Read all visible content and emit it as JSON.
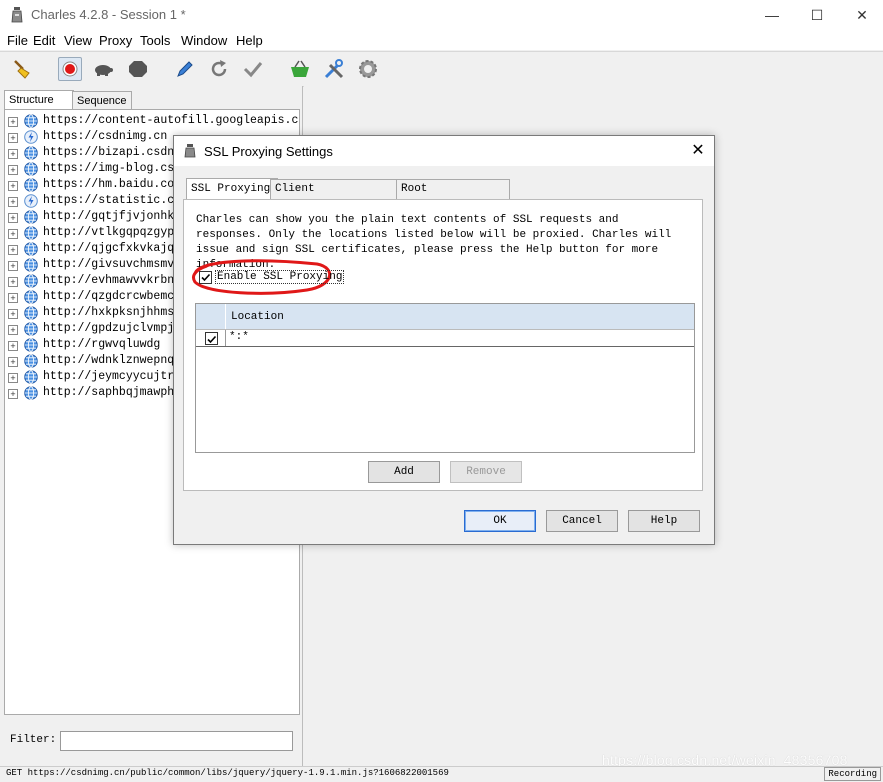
{
  "window": {
    "title": "Charles 4.2.8 - Session 1 *",
    "minimize": "—",
    "maximize": "☐",
    "close": "✕"
  },
  "menu": [
    "File",
    "Edit",
    "View",
    "Proxy",
    "Tools",
    "Window",
    "Help"
  ],
  "toolbar": {
    "icons": [
      "broom-icon",
      "record-icon",
      "turtle-icon",
      "stop-icon",
      "pen-icon",
      "refresh-icon",
      "check-icon",
      "basket-icon",
      "tools-icon",
      "settings-icon"
    ]
  },
  "left_tabs": [
    "Structure",
    "Sequence"
  ],
  "tree": [
    {
      "host": "https://content-autofill.googleapis.com",
      "icon": "globe"
    },
    {
      "host": "https://csdnimg.cn",
      "icon": "lightning"
    },
    {
      "host": "https://bizapi.csdn.net",
      "icon": "globe"
    },
    {
      "host": "https://img-blog.csdnimg.cn",
      "icon": "globe"
    },
    {
      "host": "https://hm.baidu.com",
      "icon": "globe"
    },
    {
      "host": "https://statistic.csdn.net",
      "icon": "lightning"
    },
    {
      "host": "http://gqtjfjvjonhkn",
      "icon": "globe"
    },
    {
      "host": "http://vtlkgqpqzgypu",
      "icon": "globe"
    },
    {
      "host": "http://qjgcfxkvkajqxk",
      "icon": "globe"
    },
    {
      "host": "http://givsuvchmsmvlhr",
      "icon": "globe"
    },
    {
      "host": "http://evhmawvvkrbnbmg",
      "icon": "globe"
    },
    {
      "host": "http://qzgdcrcwbemc",
      "icon": "globe"
    },
    {
      "host": "http://hxkpksnjhhmsla",
      "icon": "globe"
    },
    {
      "host": "http://gpdzujclvmpji",
      "icon": "globe"
    },
    {
      "host": "http://rgwvqluwdg",
      "icon": "globe"
    },
    {
      "host": "http://wdnklznwepnqpxi",
      "icon": "globe"
    },
    {
      "host": "http://jeymcyycujtr",
      "icon": "globe"
    },
    {
      "host": "http://saphbqjmawphqvy",
      "icon": "globe"
    }
  ],
  "filter": {
    "label": "Filter:",
    "value": ""
  },
  "status": {
    "text": "GET https://csdnimg.cn/public/common/libs/jquery/jquery-1.9.1.min.js?1606822001569",
    "recording": "Recording"
  },
  "watermark": "https://blog.csdn.net/weixin_48356708",
  "dialog": {
    "title": "SSL Proxying Settings",
    "close": "✕",
    "tabs": [
      "SSL Proxying",
      "Client Certificates",
      "Root Certificate"
    ],
    "description": "Charles can show you the plain text contents of SSL requests and responses. Only the locations listed below will be proxied. Charles will issue and sign SSL certificates, please press the Help button for more information.",
    "enable_label": "Enable SSL Proxying",
    "enable_checked": true,
    "table": {
      "header": "Location",
      "rows": [
        {
          "checked": true,
          "location": "*:*"
        }
      ]
    },
    "add": "Add",
    "remove": "Remove",
    "ok": "OK",
    "cancel": "Cancel",
    "help": "Help"
  }
}
